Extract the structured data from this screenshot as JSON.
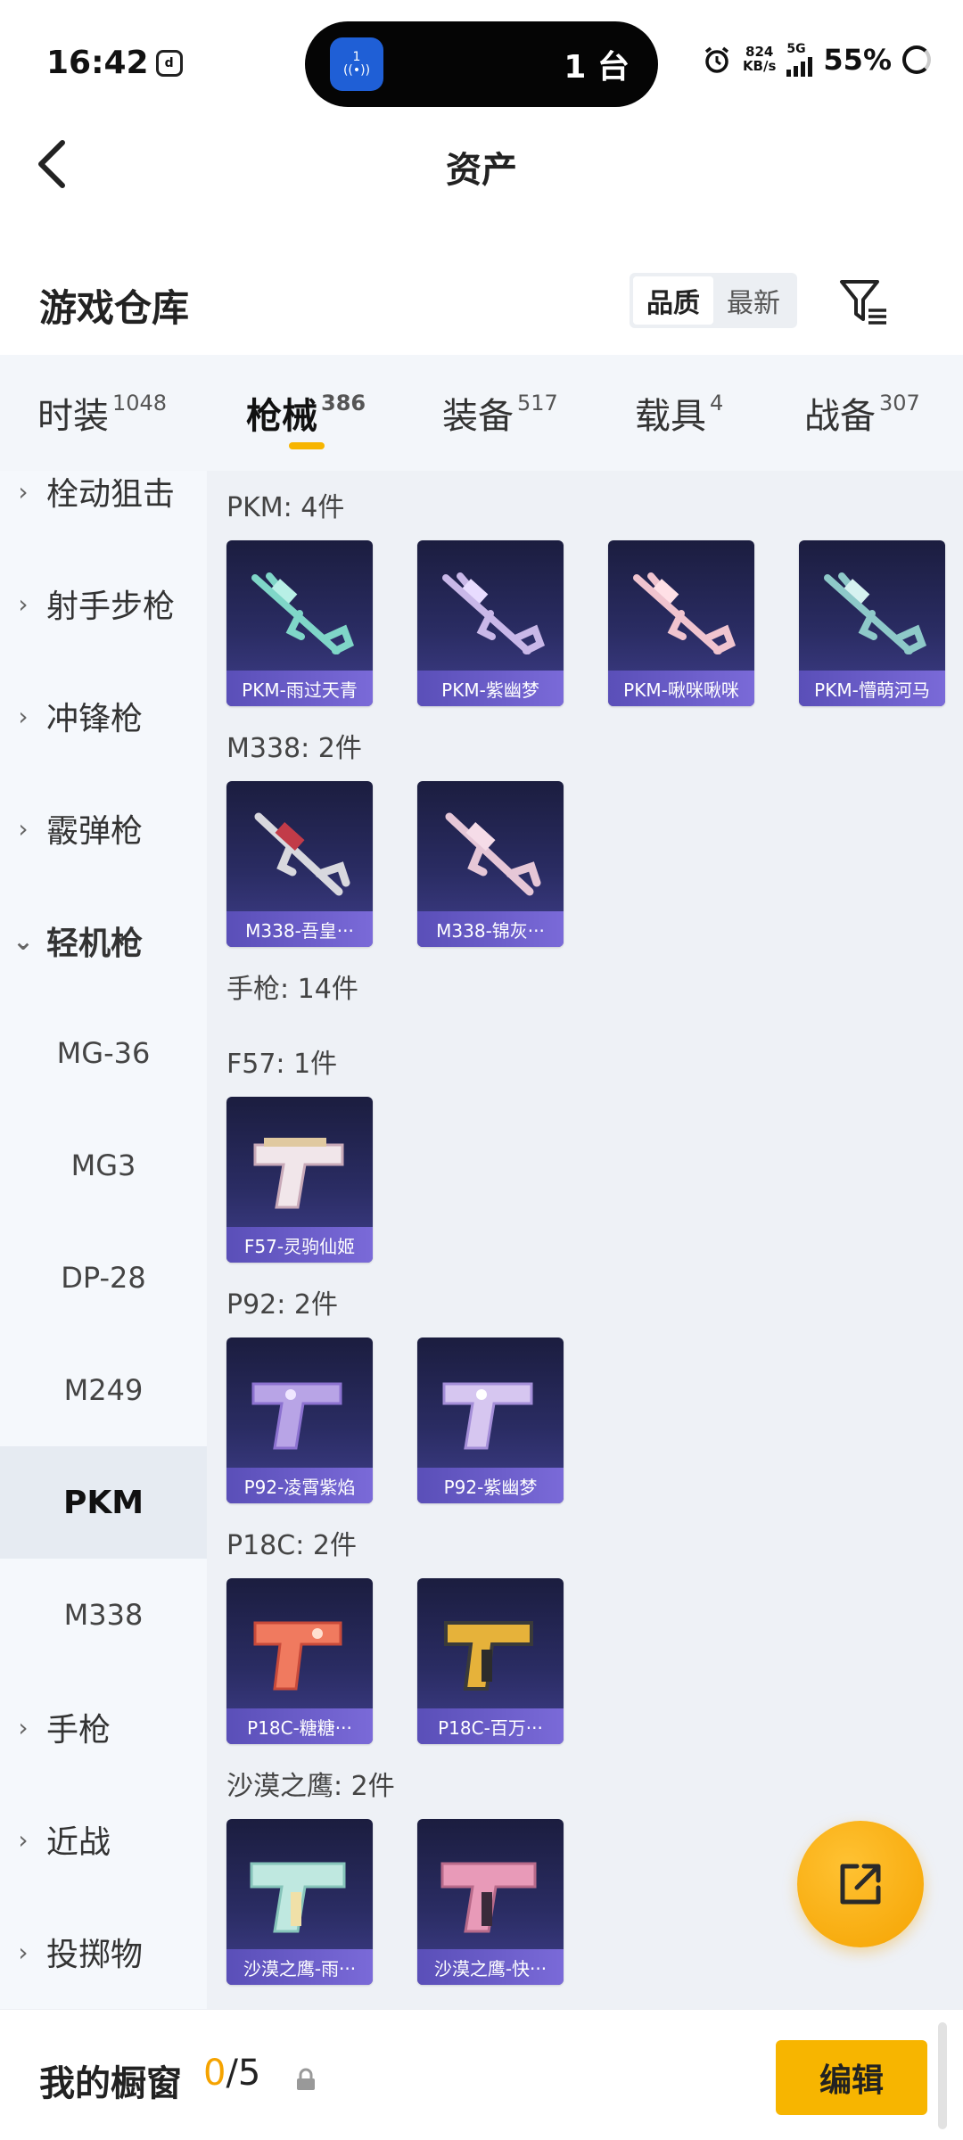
{
  "status": {
    "time": "16:42",
    "island_badge": "1",
    "island_text": "1 台",
    "speed_value": "824",
    "speed_unit": "KB/s",
    "network": "5G",
    "battery": "55%"
  },
  "header": {
    "title": "资产"
  },
  "warehouse": {
    "title": "游戏仓库",
    "sort": [
      "品质",
      "最新"
    ],
    "active_sort": "品质"
  },
  "tabs": [
    {
      "label": "时装",
      "count": "1048"
    },
    {
      "label": "枪械",
      "count": "386"
    },
    {
      "label": "装备",
      "count": "517"
    },
    {
      "label": "载具",
      "count": "4"
    },
    {
      "label": "战备",
      "count": "307"
    }
  ],
  "active_tab": "枪械",
  "sidebar": {
    "items": [
      {
        "label": "栓动狙击"
      },
      {
        "label": "射手步枪"
      },
      {
        "label": "冲锋枪"
      },
      {
        "label": "霰弹枪"
      },
      {
        "label": "轻机枪"
      },
      {
        "label": "MG-36"
      },
      {
        "label": "MG3"
      },
      {
        "label": "DP-28"
      },
      {
        "label": "M249"
      },
      {
        "label": "PKM"
      },
      {
        "label": "M338"
      },
      {
        "label": "手枪"
      },
      {
        "label": "近战"
      },
      {
        "label": "投掷物"
      }
    ]
  },
  "groups": {
    "pkm": {
      "title": "PKM: 4件",
      "items": [
        "PKM-雨过天青",
        "PKM-紫幽梦",
        "PKM-啾咪啾咪",
        "PKM-懵萌河马"
      ]
    },
    "m338": {
      "title": "M338: 2件",
      "items": [
        "M338-吾皇···",
        "M338-锦灰···"
      ]
    },
    "pistol": {
      "title": "手枪: 14件"
    },
    "f57": {
      "title": "F57: 1件",
      "items": [
        "F57-灵驹仙姬"
      ]
    },
    "p92": {
      "title": "P92: 2件",
      "items": [
        "P92-凌霄紫焰",
        "P92-紫幽梦"
      ]
    },
    "p18c": {
      "title": "P18C: 2件",
      "items": [
        "P18C-糖糖···",
        "P18C-百万···"
      ]
    },
    "deagle": {
      "title": "沙漠之鹰: 2件",
      "items": [
        "沙漠之鹰-雨···",
        "沙漠之鹰-快···"
      ]
    }
  },
  "bottom": {
    "title": "我的橱窗",
    "count_current": "0",
    "count_total": "/5",
    "edit": "编辑"
  },
  "colors": {
    "accent": "#f7b500",
    "card_bg": "#2a2c63",
    "card_label": "#6a5cc8"
  }
}
